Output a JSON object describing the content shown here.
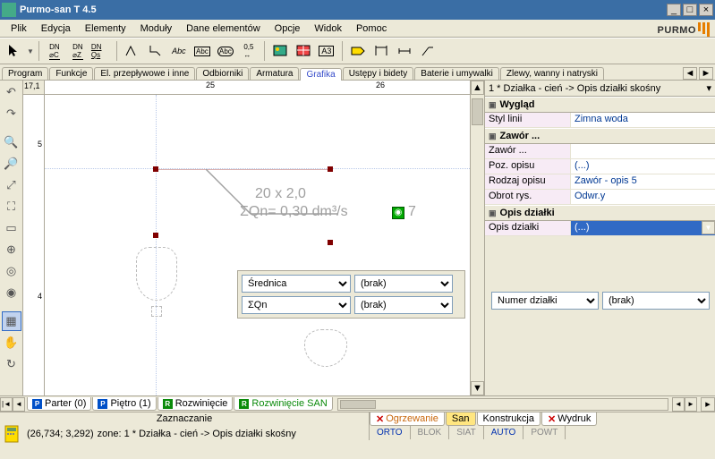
{
  "title": "Purmo-san T 4.5",
  "brand": "PURMO",
  "menu": [
    "Plik",
    "Edycja",
    "Elementy",
    "Moduły",
    "Dane elementów",
    "Opcje",
    "Widok",
    "Pomoc"
  ],
  "tabs": [
    "Program",
    "Funkcje",
    "El. przepływowe i inne",
    "Odbiorniki",
    "Armatura",
    "Grafika",
    "Ustępy i bidety",
    "Baterie i umywalki",
    "Zlewy, wanny i natryski"
  ],
  "tabs_active": 5,
  "ruler_corner": "17,1",
  "ruler_h": [
    "25",
    "26"
  ],
  "ruler_v": [
    "5",
    "4"
  ],
  "canvas": {
    "line1": "20 x 2,0",
    "line2": "ΣQn= 0,30 dm³/s",
    "marker_num": "7"
  },
  "panel_title": "1 * Działka - cień -> Opis działki skośny",
  "props": {
    "g1": "Wygląd",
    "r1k": "Styl linii",
    "r1v": "Zimna woda",
    "g2": "Zawór ...",
    "r2k": "Zawór ...",
    "r2v": "",
    "r3k": "Poz. opisu",
    "r3v": "(...)",
    "r4k": "Rodzaj opisu",
    "r4v": "Zawór - opis 5",
    "r5k": "Obrot rys.",
    "r5v": "Odwr.y",
    "g3": "Opis działki",
    "r6k": "Opis działki",
    "r6v": "(...)"
  },
  "float": {
    "f1": "Średnica",
    "f1v": "(brak)",
    "f2": "ΣQn",
    "f2v": "(brak)",
    "f3": "Numer działki",
    "f3v": "(brak)"
  },
  "btabs": [
    {
      "badge": "P",
      "cls": "p",
      "label": "Parter (0)"
    },
    {
      "badge": "P",
      "cls": "p",
      "label": "Piętro (1)"
    },
    {
      "badge": "R",
      "cls": "r",
      "label": "Rozwinięcie"
    },
    {
      "badge": "R",
      "cls": "r",
      "label": "Rozwinięcie SAN"
    }
  ],
  "status": {
    "line1": "Zaznaczanie",
    "zone": "zone: 1 * Działka - cień -> Opis działki skośny",
    "coords": "(26,734; 3,292)"
  },
  "vtabs": [
    {
      "x": true,
      "label": "Ogrzewanie",
      "act": true
    },
    {
      "label": "San"
    },
    {
      "label": "Konstrukcja"
    },
    {
      "x": true,
      "label": "Wydruk"
    }
  ],
  "modes": [
    {
      "l": "ORTO",
      "on": true
    },
    {
      "l": "BLOK"
    },
    {
      "l": "SIAT"
    },
    {
      "l": "AUTO",
      "on": true
    },
    {
      "l": "POWT"
    }
  ]
}
